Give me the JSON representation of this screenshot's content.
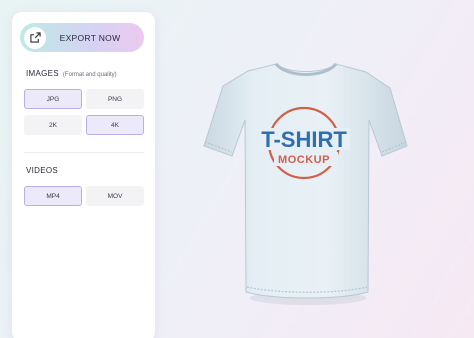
{
  "export": {
    "label": "EXPORT NOW",
    "icon": "external-link-icon"
  },
  "images": {
    "title": "IMAGES",
    "subtitle": "(Format and quality)",
    "formats": [
      {
        "label": "JPG",
        "selected": true
      },
      {
        "label": "PNG",
        "selected": false
      }
    ],
    "quality": [
      {
        "label": "2K",
        "selected": false
      },
      {
        "label": "4K",
        "selected": true
      }
    ]
  },
  "videos": {
    "title": "VIDEOS",
    "formats": [
      {
        "label": "MP4",
        "selected": true
      },
      {
        "label": "MOV",
        "selected": false
      }
    ]
  },
  "mockup": {
    "title": "T-SHIRT",
    "subtitle": "MOCKUP",
    "shirt_color": "#dde9f0",
    "title_color": "#2f6fb0",
    "accent_color": "#d0604a"
  }
}
